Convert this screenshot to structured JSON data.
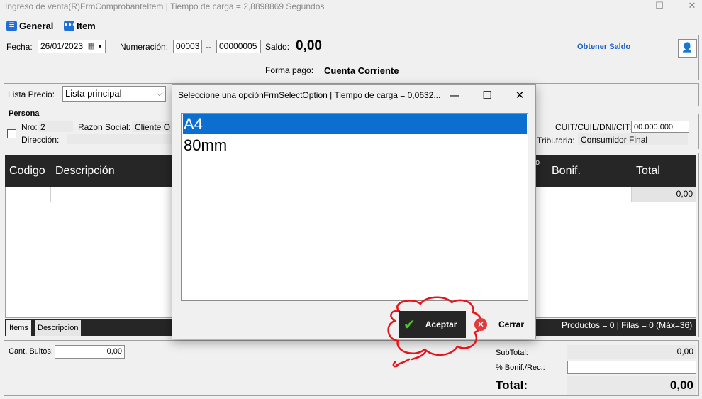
{
  "window": {
    "title": "Ingreso de venta(R)FrmComprobanteItem | Tiempo de carga = 2,8898869 Segundos",
    "minimize_glyph": "—",
    "maximize_glyph": "☐",
    "close_glyph": "✕"
  },
  "menu": {
    "general_label": "General",
    "item_label": "Item"
  },
  "header": {
    "fecha_label": "Fecha:",
    "fecha_value": "26/01/2023",
    "numeracion_label": "Numeración:",
    "numeracion_pv": "00003",
    "numeracion_sep": "--",
    "numeracion_num": "00000005",
    "saldo_label": "Saldo:",
    "saldo_value": "0,00",
    "obtener_saldo_link": "Obtener Saldo",
    "forma_pago_label": "Forma pago:",
    "forma_pago_value": "Cuenta Corriente"
  },
  "lista_precio": {
    "label": "Lista Precio:",
    "value": "Lista principal"
  },
  "persona": {
    "group_label": "Persona",
    "nro_label": "Nro:",
    "nro_value": "2",
    "razon_social_label": "Razon Social:",
    "razon_social_value": "Cliente O",
    "direccion_label": "Dirección:",
    "direccion_value": "",
    "cuit_label": "CUIT/CUIL/DNI/CIT:",
    "cuit_value": "00.000.000",
    "tributaria_label": "Tributaria:",
    "tributaria_value": "Consumidor Final"
  },
  "grid": {
    "columns": [
      "Codigo",
      "Descripción",
      "Bonif.",
      "Total"
    ],
    "partial_header_glyph": "o",
    "first_row_total": "0,00"
  },
  "tabs": [
    "Items",
    "Descripcion"
  ],
  "status_bar": "Productos = 0 | Filas = 0 (Máx=36)",
  "footer": {
    "cant_bultos_label": "Cant. Bultos:",
    "cant_bultos_value": "0,00",
    "subtotal_label": "SubTotal:",
    "subtotal_value": "0,00",
    "bonif_label": "% Bonif./Rec.:",
    "bonif_value": "",
    "total_label": "Total:",
    "total_value": "0,00"
  },
  "dialog": {
    "title": "Seleccione una opciónFrmSelectOption | Tiempo de carga = 0,0632...",
    "options": [
      "A4",
      "80mm"
    ],
    "selected_index": 0,
    "aceptar_label": "Aceptar",
    "cerrar_label": "Cerrar"
  },
  "colors": {
    "selection": "#0a6fd1",
    "header_dark": "#262626",
    "link": "#1a5fc8",
    "annotation_red": "#e8141c"
  },
  "icons": [
    "general-menu-icon",
    "item-menu-icon",
    "calendar-icon",
    "dropdown-arrow-icon",
    "user-card-icon",
    "check-icon",
    "cancel-icon"
  ]
}
